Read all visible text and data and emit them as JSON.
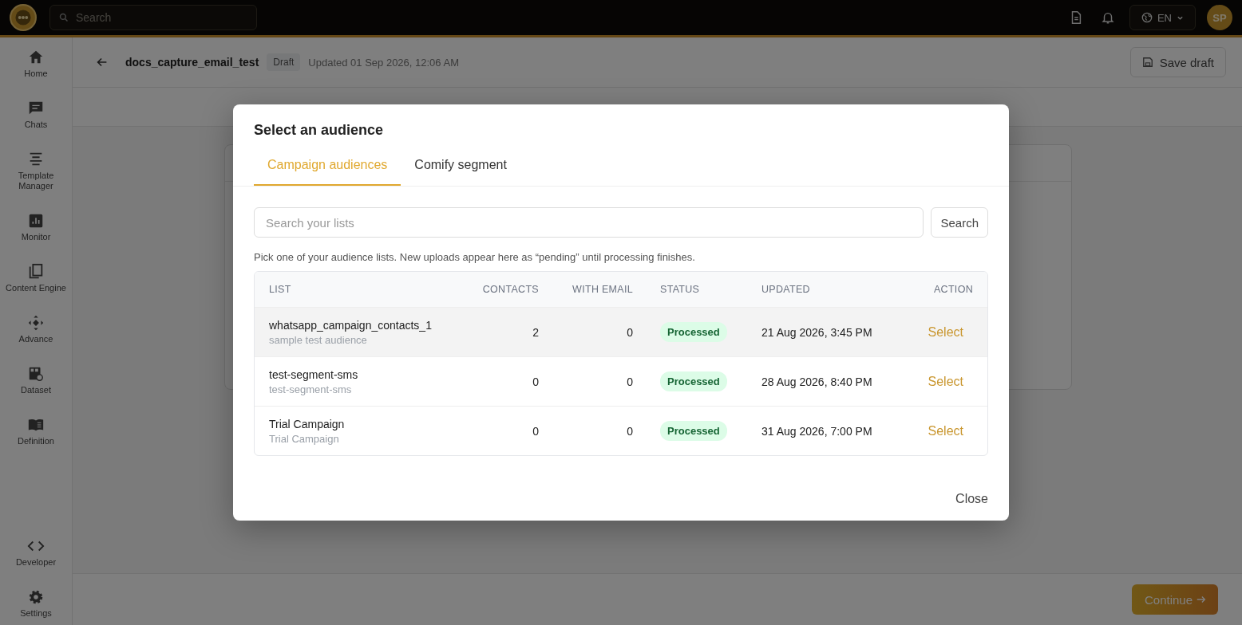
{
  "topbar": {
    "search_placeholder": "Search",
    "language": "EN",
    "avatar": "SP"
  },
  "sidebar": {
    "items": [
      {
        "label": "Home"
      },
      {
        "label": "Chats"
      },
      {
        "label": "Template Manager"
      },
      {
        "label": "Monitor"
      },
      {
        "label": "Content Engine"
      },
      {
        "label": "Advance"
      },
      {
        "label": "Dataset"
      },
      {
        "label": "Definition"
      }
    ],
    "bottom_items": [
      {
        "label": "Developer"
      },
      {
        "label": "Settings"
      }
    ]
  },
  "header": {
    "title": "docs_capture_email_test",
    "badge": "Draft",
    "updated": "Updated 01 Sep 2026, 12:06 AM",
    "save_button": "Save draft"
  },
  "modal": {
    "title": "Select an audience",
    "tabs": [
      {
        "label": "Campaign audiences",
        "selected": true
      },
      {
        "label": "Comify segment",
        "selected": false
      }
    ],
    "search_placeholder": "Search your lists",
    "search_button": "Search",
    "hint": "Pick one of your audience lists. New uploads appear here as “pending” until processing finishes.",
    "columns": [
      "LIST",
      "CONTACTS",
      "WITH EMAIL",
      "STATUS",
      "UPDATED",
      "ACTION"
    ],
    "rows": [
      {
        "name": "whatsapp_campaign_contacts_1",
        "description": "sample test audience",
        "contacts": "2",
        "with_email": "0",
        "status": "Processed",
        "updated": "21 Aug 2026, 3:45 PM",
        "action": "Select",
        "selected": true
      },
      {
        "name": "test-segment-sms",
        "description": "test-segment-sms",
        "contacts": "0",
        "with_email": "0",
        "status": "Processed",
        "updated": "28 Aug 2026, 8:40 PM",
        "action": "Select",
        "selected": false
      },
      {
        "name": "Trial Campaign",
        "description": "Trial Campaign",
        "contacts": "0",
        "with_email": "0",
        "status": "Processed",
        "updated": "31 Aug 2026, 7:00 PM",
        "action": "Select",
        "selected": false
      }
    ],
    "close_button": "Close"
  },
  "footer": {
    "continue_button": "Continue"
  }
}
